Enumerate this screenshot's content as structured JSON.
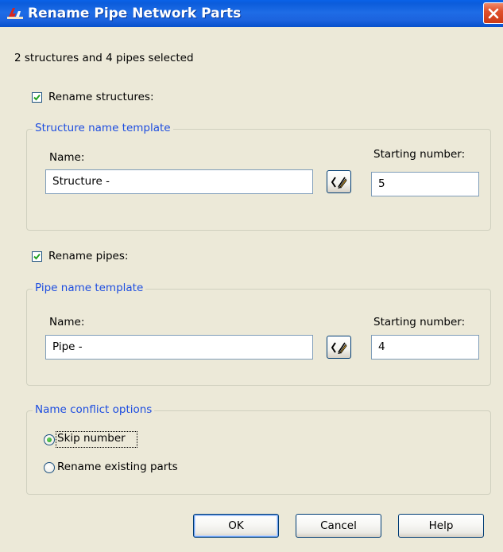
{
  "window": {
    "title": "Rename Pipe Network Parts"
  },
  "selection_summary": "2 structures and 4 pipes selected",
  "rename_structures": {
    "label": "Rename structures:",
    "checked": true
  },
  "structure_template": {
    "legend": "Structure name template",
    "name_label": "Name:",
    "name_value": "Structure -",
    "starting_number_label": "Starting number:",
    "starting_number_value": "5"
  },
  "rename_pipes": {
    "label": "Rename pipes:",
    "checked": true
  },
  "pipe_template": {
    "legend": "Pipe name template",
    "name_label": "Name:",
    "name_value": "Pipe -",
    "starting_number_label": "Starting number:",
    "starting_number_value": "4"
  },
  "conflict_options": {
    "legend": "Name conflict options",
    "options": [
      {
        "label": "Skip number",
        "selected": true
      },
      {
        "label": "Rename existing parts",
        "selected": false
      }
    ]
  },
  "buttons": {
    "ok": "OK",
    "cancel": "Cancel",
    "help": "Help"
  },
  "colors": {
    "titlebar": "#0B5CDB",
    "close": "#E0502C",
    "dialog_bg": "#ECE9D8",
    "group_title": "#1D4DE0",
    "check_mark": "#21A121"
  },
  "icons": {
    "app": "autocad-civil-icon",
    "close": "close-x-icon",
    "name_picker": "name-template-editor-icon"
  }
}
